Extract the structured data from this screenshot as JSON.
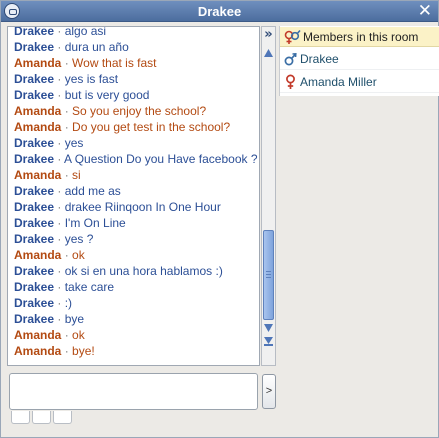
{
  "window": {
    "title": "Drakee"
  },
  "chat": {
    "messages": [
      {
        "sender": "Drakee",
        "text": "algo asi",
        "who": "drakee"
      },
      {
        "sender": "Drakee",
        "text": "dura un año",
        "who": "drakee"
      },
      {
        "sender": "Amanda",
        "text": "Wow that is fast",
        "who": "amanda"
      },
      {
        "sender": "Drakee",
        "text": "yes is fast",
        "who": "drakee"
      },
      {
        "sender": "Drakee",
        "text": "but is very good",
        "who": "drakee"
      },
      {
        "sender": "Amanda",
        "text": "So you enjoy the school?",
        "who": "amanda"
      },
      {
        "sender": "Amanda",
        "text": "Do you get test in the school?",
        "who": "amanda"
      },
      {
        "sender": "Drakee",
        "text": "yes",
        "who": "drakee"
      },
      {
        "sender": "Drakee",
        "text": "A Question Do you Have facebook ?",
        "who": "drakee"
      },
      {
        "sender": "Amanda",
        "text": "si",
        "who": "amanda"
      },
      {
        "sender": "Drakee",
        "text": "add me as",
        "who": "drakee"
      },
      {
        "sender": "Drakee",
        "text": "drakee Riinqoon In One Hour",
        "who": "drakee"
      },
      {
        "sender": "Drakee",
        "text": "I'm On Line",
        "who": "drakee"
      },
      {
        "sender": "Drakee",
        "text": "yes ?",
        "who": "drakee"
      },
      {
        "sender": "Amanda",
        "text": "ok",
        "who": "amanda"
      },
      {
        "sender": "Drakee",
        "text": "ok si en una hora hablamos :)",
        "who": "drakee"
      },
      {
        "sender": "Drakee",
        "text": "take care",
        "who": "drakee"
      },
      {
        "sender": "Drakee",
        "text": ":)",
        "who": "drakee"
      },
      {
        "sender": "Drakee",
        "text": "bye",
        "who": "drakee"
      },
      {
        "sender": "Amanda",
        "text": "ok",
        "who": "amanda"
      },
      {
        "sender": "Amanda",
        "text": "bye!",
        "who": "amanda"
      }
    ],
    "separator": "·",
    "input_value": ""
  },
  "members": {
    "header": "Members in this room",
    "list": [
      {
        "name": "Drakee",
        "gender": "male"
      },
      {
        "name": "Amanda Miller",
        "gender": "female"
      }
    ]
  },
  "controls": {
    "send_label": ">",
    "collapse_label": "»"
  },
  "icons": {
    "app": "chat-bubble-icon",
    "close": "close-icon",
    "members_header": "gender-pair-icon",
    "male": "male-symbol-icon",
    "female": "female-symbol-icon"
  },
  "colors": {
    "drakee": "#2c4f96",
    "amanda": "#b34a12",
    "titlebar": "#5a7aab",
    "members_header_bg": "#fbf2c7"
  }
}
